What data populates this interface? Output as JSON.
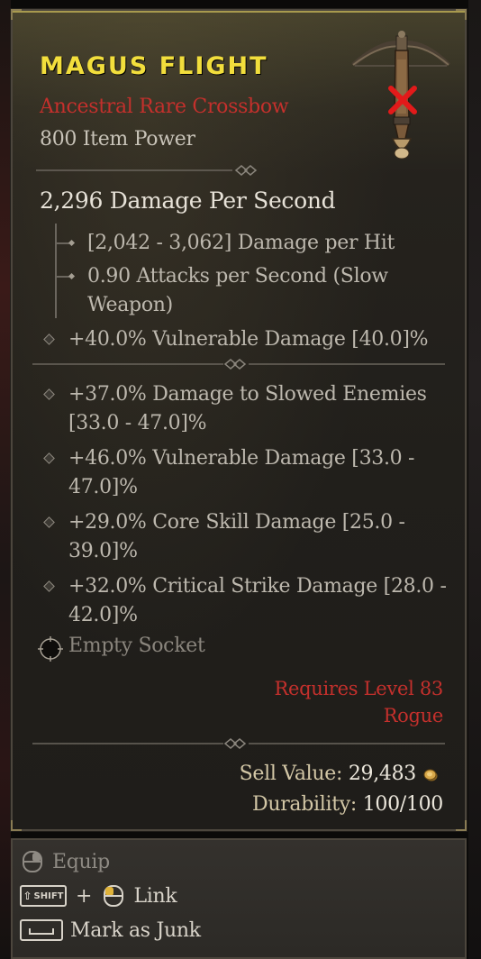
{
  "item": {
    "name": "MAGUS FLIGHT",
    "type_line": "Ancestral Rare Crossbow",
    "item_power": "800 Item Power",
    "icon": "crossbow-icon",
    "unusable_marker": "red-x-icon"
  },
  "weapon": {
    "dps": "2,296 Damage Per Second",
    "damage_per_hit": "[2,042 - 3,062] Damage per Hit",
    "attack_speed_line1": "0.90 Attacks per Second (Slow",
    "attack_speed_line2": "Weapon)"
  },
  "implicit": {
    "text": "+40.0% Vulnerable Damage [40.0]%"
  },
  "affixes": [
    {
      "line1": "+37.0% Damage to Slowed Enemies",
      "line2": "[33.0 - 47.0]%"
    },
    {
      "line1": "+46.0% Vulnerable Damage [33.0 -",
      "line2": "47.0]%"
    },
    {
      "line1": "+29.0% Core Skill Damage [25.0 -",
      "line2": "39.0]%"
    },
    {
      "line1": "+32.0% Critical Strike Damage [28.0 -",
      "line2": "42.0]%"
    }
  ],
  "socket": {
    "label": "Empty Socket"
  },
  "requirements": {
    "level": "Requires Level 83",
    "class": "Rogue"
  },
  "footer": {
    "sell_label": "Sell Value:",
    "sell_value": "29,483",
    "durability_label": "Durability:",
    "durability_value": "100/100"
  },
  "actions": {
    "equip": "Equip",
    "plus": "+",
    "shift_key": "SHIFT",
    "link": "Link",
    "junk": "Mark as Junk"
  },
  "colors": {
    "title": "#f2de3c",
    "rare_type": "#c4302c",
    "requirement": "#c4302c",
    "stat_text": "#bdb8ae"
  }
}
